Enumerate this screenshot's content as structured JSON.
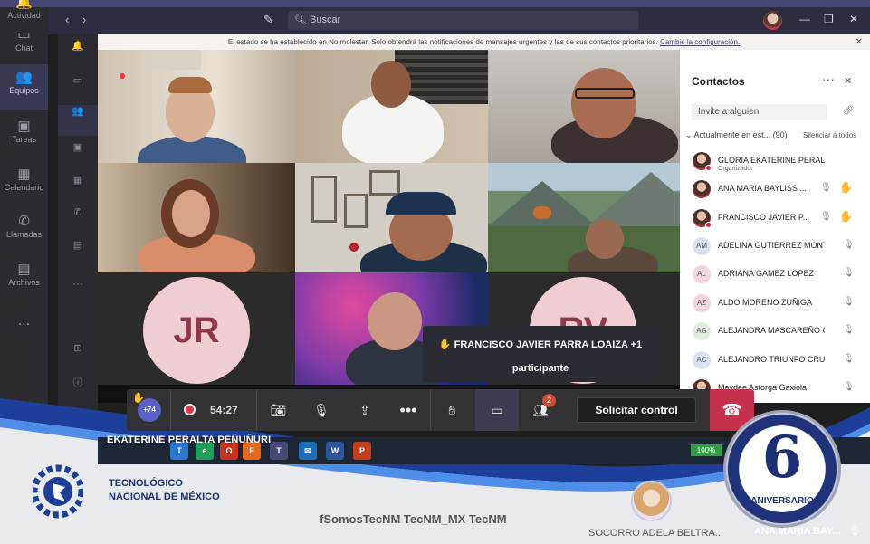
{
  "rail": {
    "items": [
      {
        "label": "Actividad",
        "icon": "bell-icon"
      },
      {
        "label": "Chat",
        "icon": "chat-icon"
      },
      {
        "label": "Equipos",
        "icon": "teams-icon"
      },
      {
        "label": "Tareas",
        "icon": "briefcase-icon"
      },
      {
        "label": "Calendario",
        "icon": "calendar-icon"
      },
      {
        "label": "Llamadas",
        "icon": "phone-icon"
      },
      {
        "label": "Archivos",
        "icon": "file-icon"
      }
    ],
    "more": "..."
  },
  "titlebar": {
    "search_placeholder": "Buscar"
  },
  "dnd_banner": {
    "text": "El estado se ha establecido en No molestar. Solo obtendrá las notificaciones de mensajes urgentes y las de sus contactos prioritarios.",
    "link": "Cambie la configuración."
  },
  "tiles": {
    "jr": "JR",
    "rv": "RV"
  },
  "contacts": {
    "title": "Contactos",
    "invite_placeholder": "Invite a alguien",
    "section": "Actualmente en est...",
    "count": "(90)",
    "silence_all": "Silenciar a todos",
    "people": [
      {
        "name": "GLORIA EKATERINE PERALTA PEÑ...",
        "role": "Organizador",
        "initials": "",
        "photo": true,
        "state": "none"
      },
      {
        "name": "ANA MARIA BAYLISS ...",
        "role": "",
        "initials": "",
        "photo": true,
        "state": "hand"
      },
      {
        "name": "FRANCISCO JAVIER P...",
        "role": "",
        "initials": "",
        "photo": true,
        "state": "hand"
      },
      {
        "name": "ADELINA GUTIERREZ MONT...",
        "role": "",
        "initials": "AM",
        "photo": false,
        "state": "muted"
      },
      {
        "name": "ADRIANA GAMEZ LOPEZ",
        "role": "",
        "initials": "AL",
        "photo": false,
        "state": "muted"
      },
      {
        "name": "ALDO MORENO ZUÑIGA",
        "role": "",
        "initials": "AZ",
        "photo": false,
        "state": "muted"
      },
      {
        "name": "ALEJANDRA MASCAREÑO G...",
        "role": "",
        "initials": "AG",
        "photo": false,
        "state": "muted"
      },
      {
        "name": "ALEJANDRO TRIUNFO CRUZ",
        "role": "",
        "initials": "AC",
        "photo": false,
        "state": "muted"
      },
      {
        "name": "Maydee Astorga Gaxiola",
        "role": "",
        "initials": "",
        "photo": true,
        "state": "muted"
      }
    ]
  },
  "notification": {
    "line1": "FRANCISCO JAVIER PARRA LOAIZA +1",
    "line2": "participante"
  },
  "callbar": {
    "raised_count": "+74",
    "timer": "54:27",
    "chat_badge": "2",
    "request_control": "Solicitar control"
  },
  "presenter_name": "EKATERINE PERALTA PEÑUÑURI",
  "taskbar": {
    "battery": "100%"
  },
  "branding": {
    "institution_line1": "TECNOLÓGICO",
    "institution_line2": "NACIONAL DE MÉXICO",
    "social": "fSomosTecNM  TecNM_MX  TecNM",
    "anniversary_number": "6",
    "anniversary_label": "ANIVERSARIO",
    "thumb_name": "SOCORRO ADELA BELTRA...",
    "thumb_name2": "ANA MARIA BAY..."
  }
}
